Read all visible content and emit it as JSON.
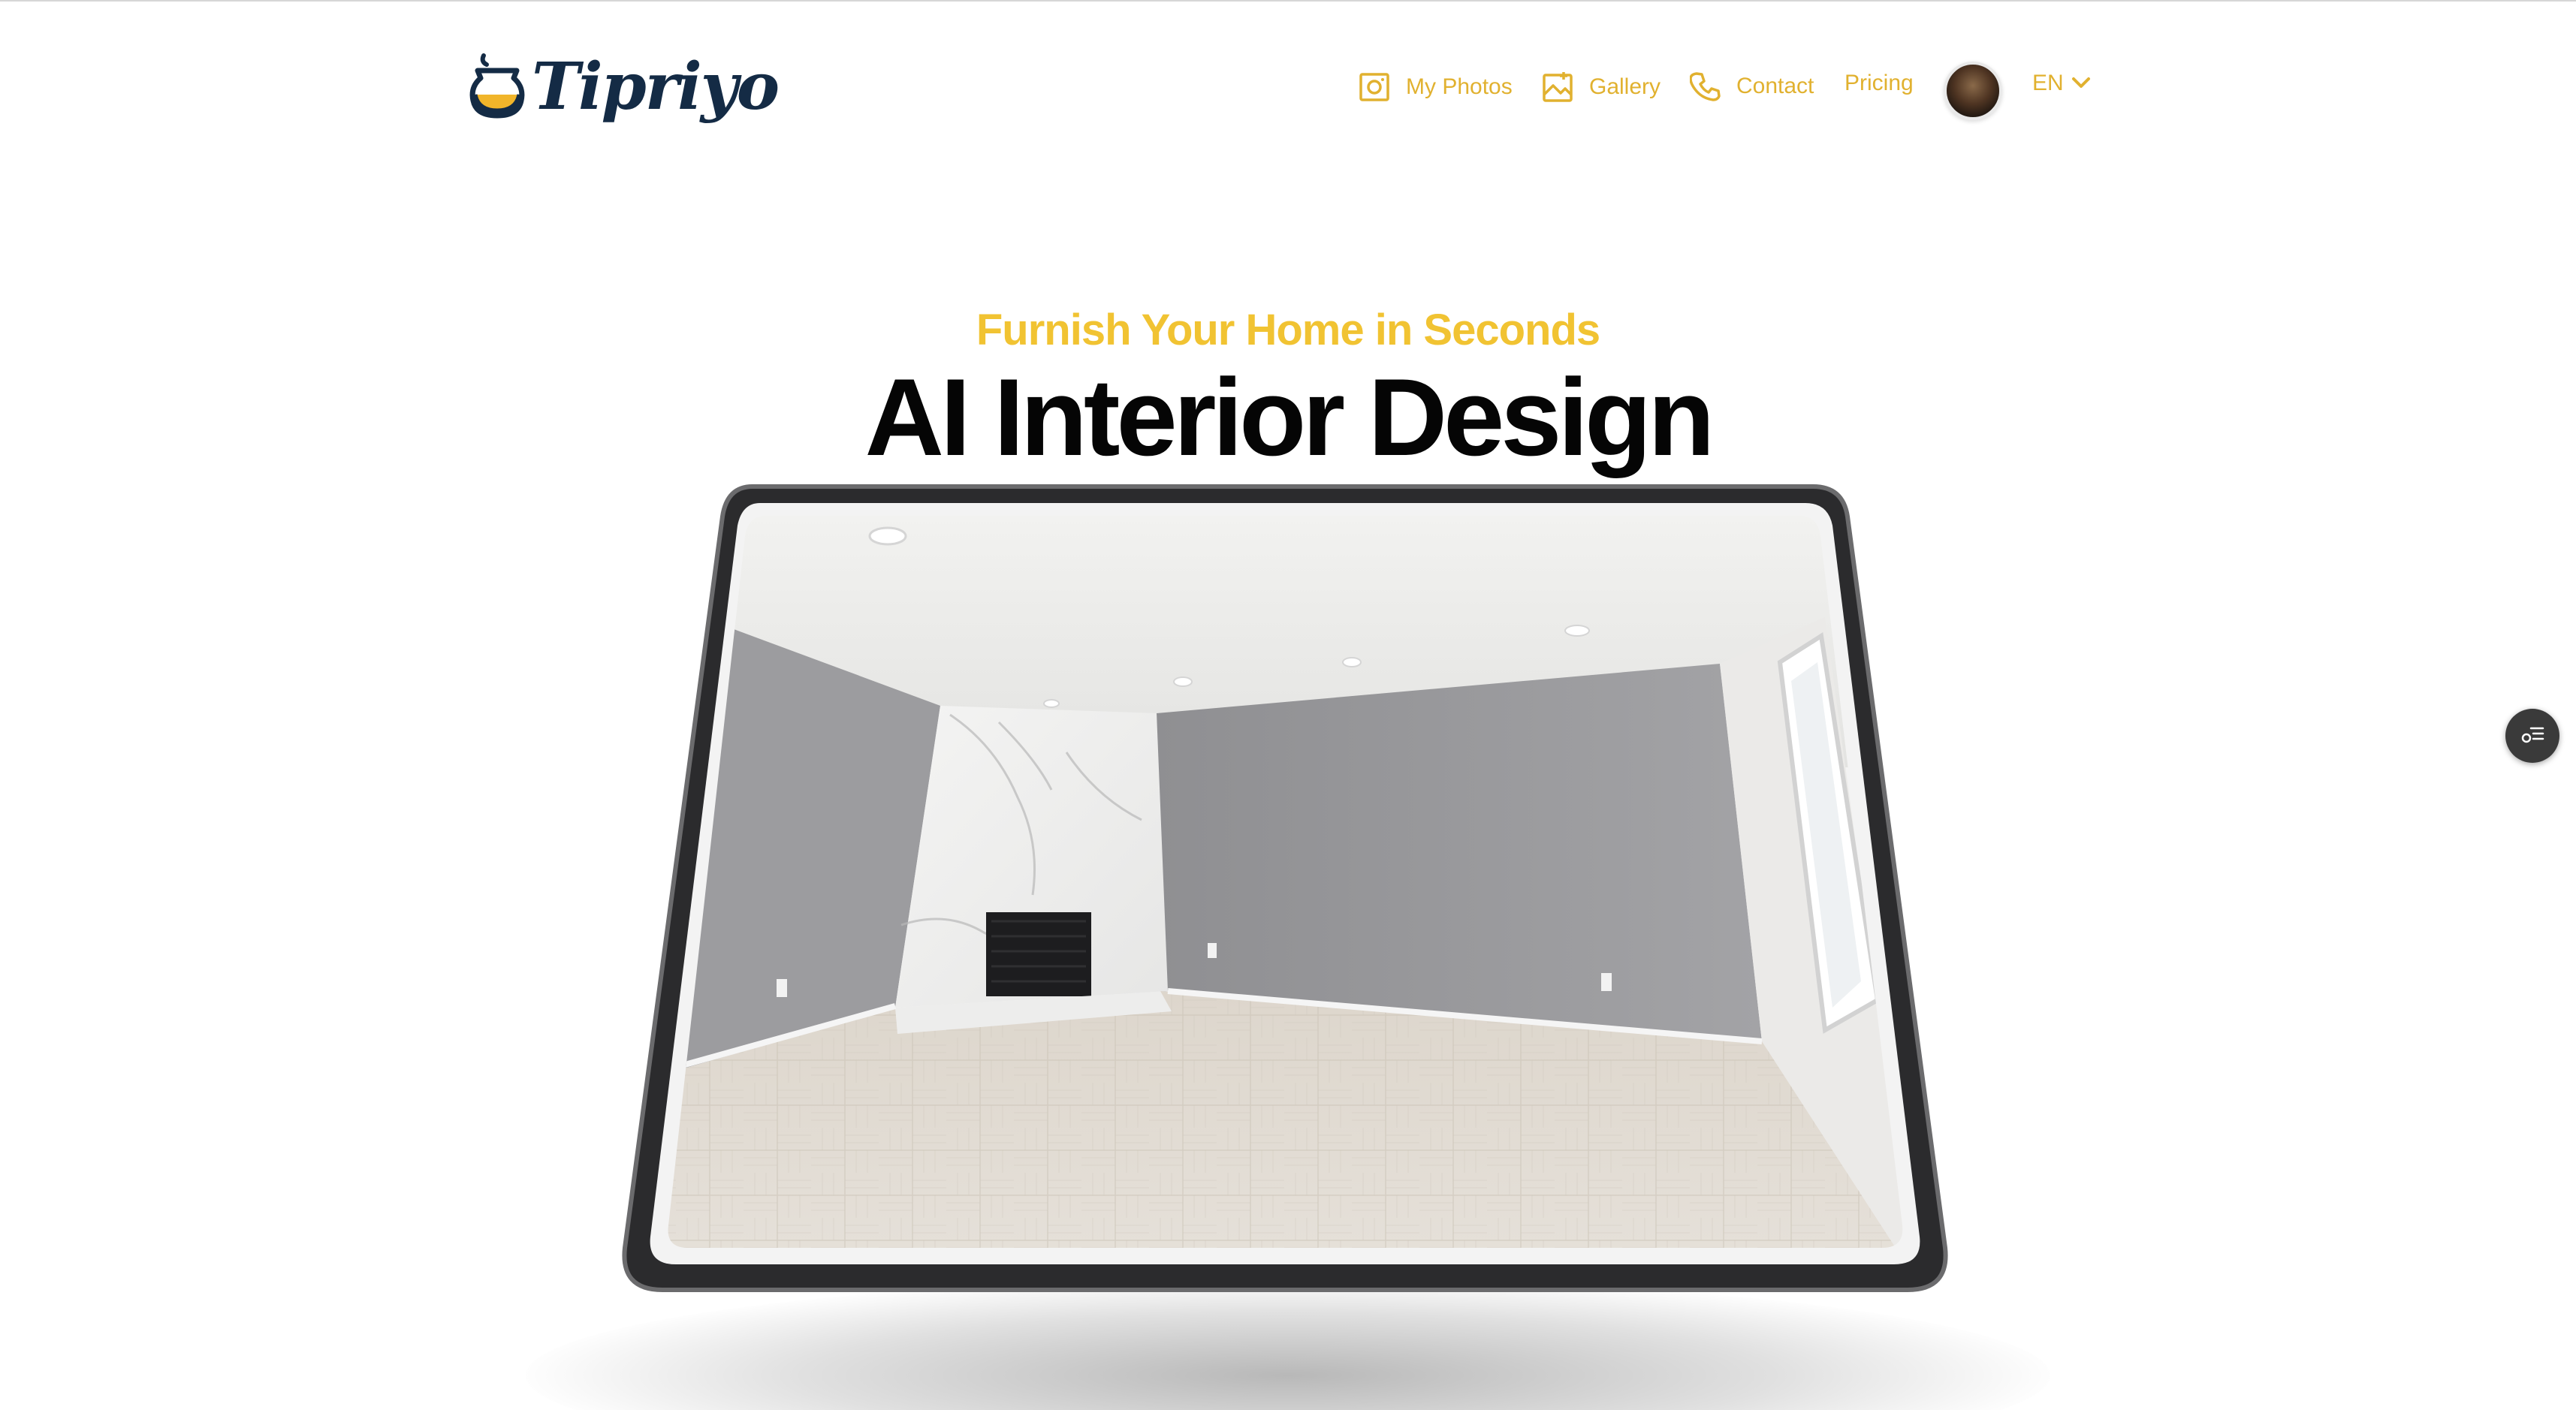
{
  "brand": {
    "name": "Tipriyo",
    "logo_icon": "jar-icon",
    "color": "#142b45",
    "accent": "#f1c332"
  },
  "nav": {
    "items": [
      {
        "label": "My Photos",
        "icon": "photo-frame-icon"
      },
      {
        "label": "Gallery",
        "icon": "gallery-icon"
      },
      {
        "label": "Contact",
        "icon": "phone-icon"
      },
      {
        "label": "Pricing",
        "icon": ""
      }
    ],
    "avatar": "user-avatar",
    "language": {
      "selected": "EN",
      "icon": "chevron-down-icon"
    },
    "link_color": "#e1b12f"
  },
  "hero": {
    "subtitle": "Furnish Your Home in Seconds",
    "title": "AI Interior Design",
    "image_alt": "empty living room with marble corner fireplace"
  },
  "floating_widget": {
    "icon": "settings-list-icon"
  }
}
